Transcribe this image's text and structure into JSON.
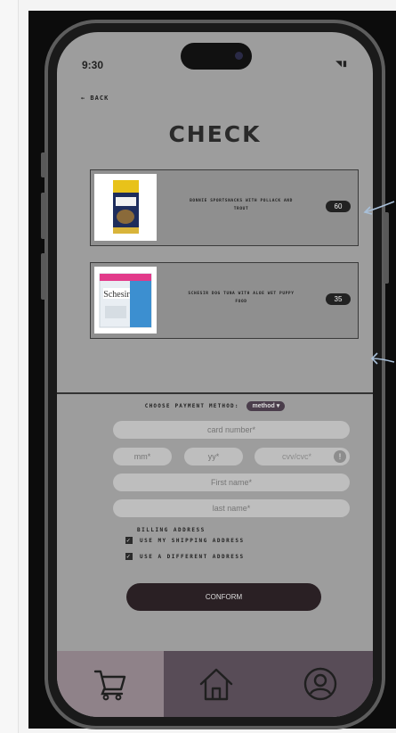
{
  "status_bar": {
    "time": "9:30",
    "icons": "◥▮"
  },
  "nav": {
    "back_label": "← BACK"
  },
  "page": {
    "title": "CHECK"
  },
  "cart": {
    "items": [
      {
        "name": "BONNIE SPORTSNACKS WITH POLLACK AND TROUT",
        "qty": "60",
        "image": "treat-bag-image"
      },
      {
        "name": "SCHESIR DOG TUNA WITH ALOE WET PUPPY FOOD",
        "qty": "35",
        "image": "schesir-box-image"
      }
    ]
  },
  "payment": {
    "prompt": "CHOOSE PAYMENT METHOD:",
    "method_label": "method ▾",
    "card_number_placeholder": "card number*",
    "mm_placeholder": "mm*",
    "yy_placeholder": "yy*",
    "cvv_placeholder": "cvv/cvc*",
    "cvv_info_glyph": "!",
    "first_name_placeholder": "First name*",
    "last_name_placeholder": "last name*"
  },
  "billing": {
    "heading": "BILLING ADDRESS",
    "options": [
      {
        "label": "USE MY SHIPPING ADDRESS",
        "checked": true
      },
      {
        "label": "USE A DIFFERENT ADDRESS",
        "checked": true
      }
    ]
  },
  "confirm_label": "CONFORM",
  "tabs": [
    {
      "name": "cart",
      "icon": "cart-icon",
      "active": true
    },
    {
      "name": "home",
      "icon": "home-icon",
      "active": false
    },
    {
      "name": "profile",
      "icon": "user-icon",
      "active": false
    }
  ],
  "colors": {
    "screen_bg": "#9d9d9d",
    "accent_dark": "#2a2024",
    "tab_active": "#8f8289",
    "tab_inactive": "#584c57",
    "annotation_arrow": "#a8bfd8"
  }
}
